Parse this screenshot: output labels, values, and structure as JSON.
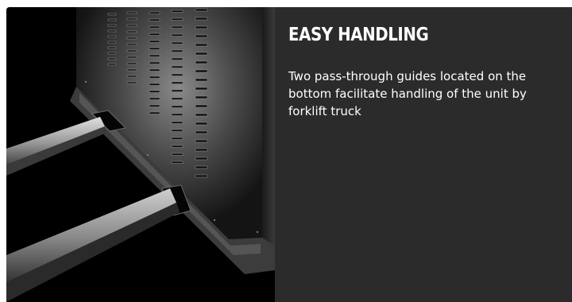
{
  "feature": {
    "title": "EASY HANDLING",
    "description": "Two pass-through guides located on the bottom facilitate handling of the unit by forklift truck"
  },
  "image": {
    "subject": "forklift-forks-under-ventilated-unit"
  },
  "colors": {
    "panel_background": "#2b2b2b",
    "image_background": "#000000",
    "text": "#ffffff"
  }
}
